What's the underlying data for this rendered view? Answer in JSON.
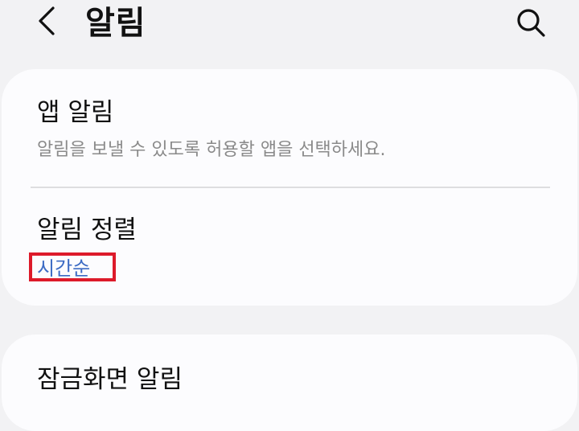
{
  "header": {
    "title": "알림",
    "back_icon": "chevron-left-icon",
    "search_icon": "search-icon"
  },
  "card1": {
    "app_notifications": {
      "title": "앱 알림",
      "subtitle": "알림을 보낼 수 있도록 허용할 앱을 선택하세요."
    },
    "sort": {
      "title": "알림 정렬",
      "value": "시간순"
    }
  },
  "card2": {
    "lockscreen": {
      "title": "잠금화면 알림"
    }
  },
  "colors": {
    "background": "#f2f2f4",
    "card": "#fcfcfe",
    "accent": "#3c6bc4",
    "highlight": "#dd1a2a"
  }
}
